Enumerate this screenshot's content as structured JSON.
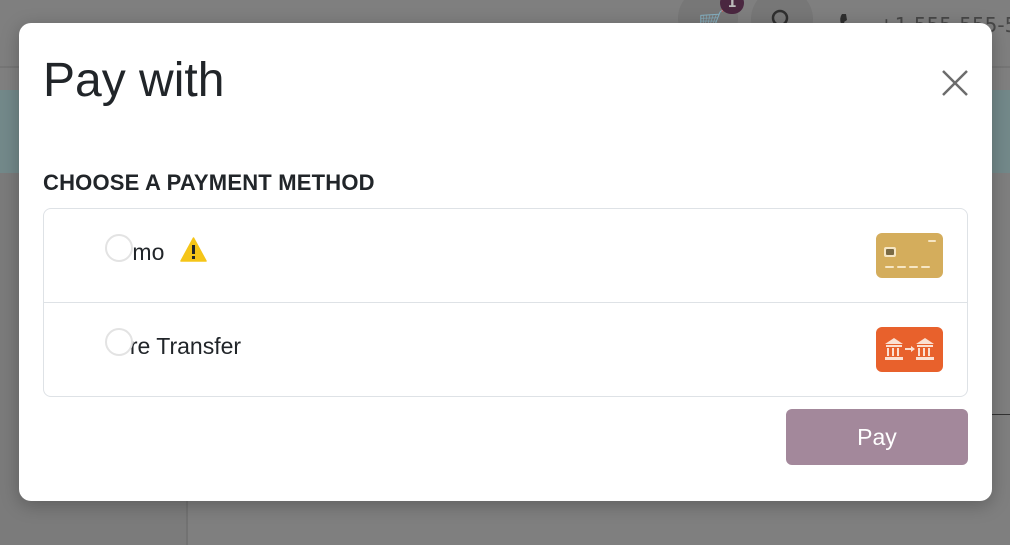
{
  "background": {
    "cart_badge": "1",
    "phone_text": "+1 555-555-5"
  },
  "modal": {
    "title": "Pay with",
    "section_title": "CHOOSE A PAYMENT METHOD",
    "methods": [
      {
        "label": "Demo",
        "visible_label": "mo",
        "logo": "credit-card-icon",
        "has_warning": true,
        "color": "#d4ad5c"
      },
      {
        "label": "Wire Transfer",
        "visible_label": "re Transfer",
        "logo": "bank-transfer-icon",
        "has_warning": false,
        "color": "#e8612c"
      }
    ],
    "pay_label": "Pay",
    "colors": {
      "pay_button": "#a3889b",
      "warning": "#f5c518",
      "overlay": "#808080"
    }
  }
}
